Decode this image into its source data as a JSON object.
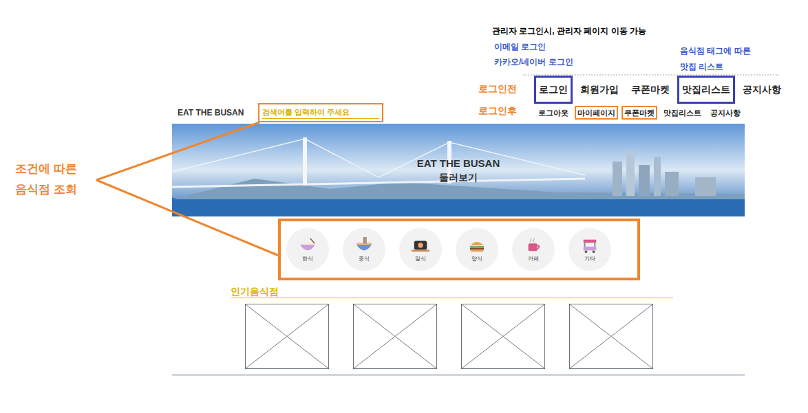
{
  "annotations": {
    "admin": "관리자 로그인시, 관리자 페이지 이동 가능",
    "login_methods": [
      "이메일 로그인",
      "카카오/네이버 로그인"
    ],
    "restaurant_list": [
      "음식점 태그에 따른",
      "맛집 리스트"
    ],
    "before_login": "로그인전",
    "after_login": "로그인후",
    "search_condition": [
      "조건에 따른",
      "음식점 조회"
    ]
  },
  "nav_before": [
    {
      "label": "로그인",
      "highlighted": true
    },
    {
      "label": "회원가입",
      "highlighted": false
    },
    {
      "label": "쿠폰마켓",
      "highlighted": false
    },
    {
      "label": "맛집리스트",
      "highlighted": true
    },
    {
      "label": "공지사항",
      "highlighted": false
    }
  ],
  "nav_after": [
    {
      "label": "로그아웃",
      "highlighted": false
    },
    {
      "label": "마이페이지",
      "highlighted": true
    },
    {
      "label": "쿠폰마켓",
      "highlighted": true
    },
    {
      "label": "맛집리스트",
      "highlighted": false
    },
    {
      "label": "공지사항",
      "highlighted": false
    }
  ],
  "brand": "EAT THE BUSAN",
  "search": {
    "placeholder": "검색어를 입력하여 주세요"
  },
  "banner": {
    "title": "EAT THE BUSAN",
    "subtitle": "둘러보기"
  },
  "categories": [
    {
      "label": "한식"
    },
    {
      "label": "중식"
    },
    {
      "label": "일식"
    },
    {
      "label": "양식"
    },
    {
      "label": "카페"
    },
    {
      "label": "기타"
    }
  ],
  "popular": {
    "title": "인기음식점",
    "cards": [
      {
        "empty": true
      },
      {
        "empty": true
      },
      {
        "empty": true
      },
      {
        "empty": true
      }
    ]
  }
}
